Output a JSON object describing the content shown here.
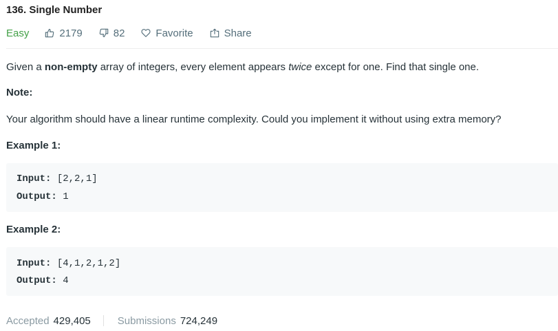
{
  "problem": {
    "title": "136. Single Number",
    "difficulty": "Easy",
    "likes": "2179",
    "dislikes": "82",
    "favorite_label": "Favorite",
    "share_label": "Share"
  },
  "description": {
    "intro_prefix": "Given a ",
    "intro_bold": "non-empty",
    "intro_middle": " array of integers, every element appears ",
    "intro_italic": "twice",
    "intro_suffix": " except for one. Find that single one.",
    "note_heading": "Note:",
    "note_text": "Your algorithm should have a linear runtime complexity. Could you implement it without using extra memory?"
  },
  "examples": [
    {
      "heading": "Example 1:",
      "input_label": "Input:",
      "input_value": " [2,2,1]",
      "output_label": "Output:",
      "output_value": " 1"
    },
    {
      "heading": "Example 2:",
      "input_label": "Input:",
      "input_value": " [4,1,2,1,2]",
      "output_label": "Output:",
      "output_value": " 4"
    }
  ],
  "stats": {
    "accepted_label": "Accepted",
    "accepted_value": "429,405",
    "submissions_label": "Submissions",
    "submissions_value": "724,249"
  },
  "icons": {
    "likes": "thumbs-up-icon",
    "dislikes": "thumbs-down-icon",
    "favorite": "heart-icon",
    "share": "share-icon"
  },
  "colors": {
    "easy": "#43a047",
    "meta_text": "#546e7a",
    "code_background": "#f7f9fa"
  }
}
